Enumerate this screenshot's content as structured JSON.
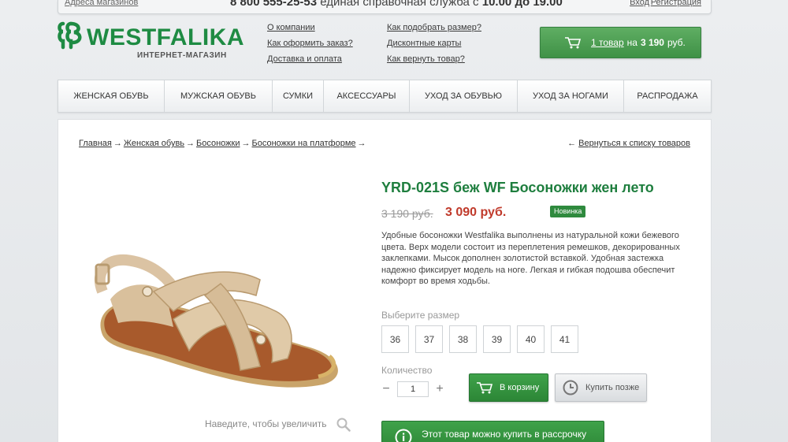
{
  "topbar": {
    "stores": "Адреса магазинов",
    "phone_number": "8 800 555-25-53",
    "phone_text": "единая справочная служба с",
    "hours_from": "10.00",
    "hours_to_word": "до",
    "hours_to": "19.00",
    "login": "Вход",
    "register": "Регистрация"
  },
  "logo": {
    "name": "WESTFALIKA",
    "tagline": "ИНТЕРНЕТ-МАГАЗИН"
  },
  "header_links": {
    "col1": [
      "О компании",
      "Как оформить заказ?",
      "Доставка и оплата"
    ],
    "col2": [
      "Как подобрать размер?",
      "Дисконтные карты",
      "Как вернуть товар?"
    ]
  },
  "cart": {
    "count": "1 товар",
    "mid": "на",
    "amount": "3 190",
    "currency": "руб."
  },
  "nav": [
    "ЖЕНСКАЯ ОБУВЬ",
    "МУЖСКАЯ ОБУВЬ",
    "СУМКИ",
    "АКСЕССУАРЫ",
    "УХОД ЗА ОБУВЬЮ",
    "УХОД ЗА НОГАМИ",
    "РАСПРОДАЖА"
  ],
  "breadcrumbs": [
    "Главная",
    "Женская обувь",
    "Босоножки",
    "Босоножки на платформе"
  ],
  "back_link": "Вернуться к списку товаров",
  "product": {
    "title": "YRD-021S беж WF Босоножки жен лето",
    "old_price": "3 190 руб.",
    "new_price": "3 090 руб.",
    "badge": "Новинка",
    "description": "Удобные босоножки Westfalika выполнены из натуральной кожи бежевого цвета. Верх модели состоит из переплетения ремешков, декорированных заклепками. Мысок дополнен золотистой вставкой. Удобная застежка надежно фиксирует модель на ноге. Легкая и гибкая подошва обеспечит комфорт во время ходьбы.",
    "zoom_hint": "Наведите, чтобы увеличить",
    "size_label": "Выберите размер",
    "sizes": [
      "36",
      "37",
      "38",
      "39",
      "40",
      "41"
    ],
    "qty_label": "Количество",
    "qty_value": "1",
    "add_to_cart": "В корзину",
    "buy_later": "Купить позже",
    "credit": "Этот товар можно купить в рассрочку"
  },
  "colors": {
    "brand_green": "#1e8b43",
    "price_red": "#c03a2b"
  }
}
